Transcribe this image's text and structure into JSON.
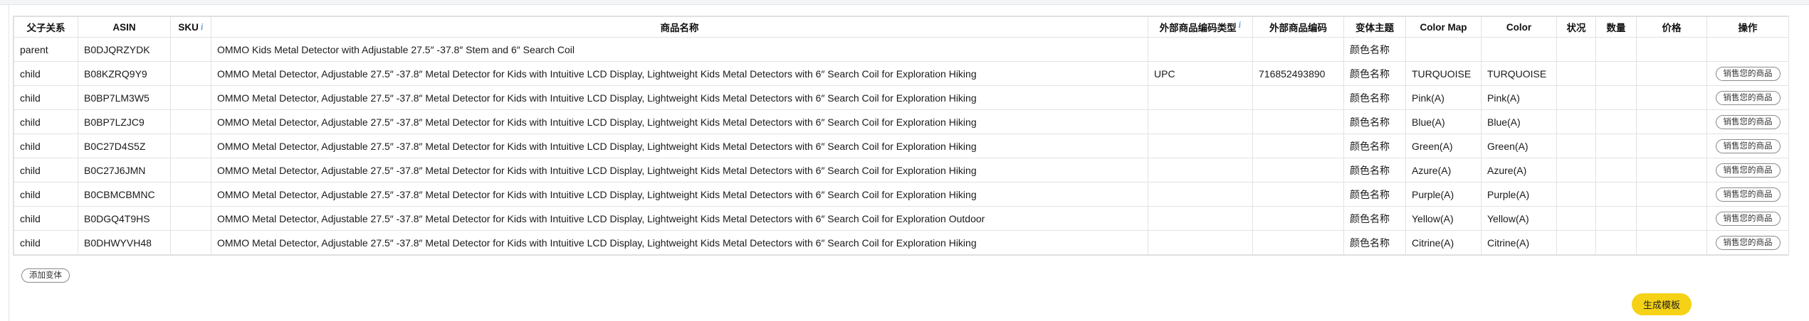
{
  "headers": {
    "relation": "父子关系",
    "asin": "ASIN",
    "sku": "SKU",
    "name": "商品名称",
    "ext_code_type": "外部商品编码类型",
    "ext_code": "外部商品编码",
    "theme": "变体主题",
    "color_map": "Color Map",
    "color": "Color",
    "status": "状况",
    "qty": "数量",
    "price": "价格",
    "action": "操作"
  },
  "info_glyph": "i",
  "rows": [
    {
      "relation": "parent",
      "asin": "B0DJQRZYDK",
      "sku": "",
      "name": "OMMO Kids Metal Detector with Adjustable 27.5″ -37.8″  Stem and 6″  Search Coil",
      "ext_code_type": "",
      "ext_code": "",
      "theme": "颜色名称",
      "color_map": "",
      "color": "",
      "status": "",
      "qty": "",
      "price": "",
      "action": ""
    },
    {
      "relation": "child",
      "asin": "B08KZRQ9Y9",
      "sku": "",
      "name": "OMMO Metal Detector, Adjustable 27.5″ -37.8″  Metal Detector for Kids with Intuitive LCD Display, Lightweight Kids Metal Detectors with 6″  Search Coil for Exploration Hiking",
      "ext_code_type": "UPC",
      "ext_code": "716852493890",
      "theme": "颜色名称",
      "color_map": "TURQUOISE",
      "color": "TURQUOISE",
      "status": "",
      "qty": "",
      "price": "",
      "action": "销售您的商品"
    },
    {
      "relation": "child",
      "asin": "B0BP7LM3W5",
      "sku": "",
      "name": "OMMO Metal Detector, Adjustable 27.5″ -37.8″  Metal Detector for Kids with Intuitive LCD Display, Lightweight Kids Metal Detectors with 6″  Search Coil for Exploration Hiking",
      "ext_code_type": "",
      "ext_code": "",
      "theme": "颜色名称",
      "color_map": "Pink(A)",
      "color": "Pink(A)",
      "status": "",
      "qty": "",
      "price": "",
      "action": "销售您的商品"
    },
    {
      "relation": "child",
      "asin": "B0BP7LZJC9",
      "sku": "",
      "name": "OMMO Metal Detector, Adjustable 27.5″ -37.8″  Metal Detector for Kids with Intuitive LCD Display, Lightweight Kids Metal Detectors with 6″  Search Coil for Exploration Hiking",
      "ext_code_type": "",
      "ext_code": "",
      "theme": "颜色名称",
      "color_map": "Blue(A)",
      "color": "Blue(A)",
      "status": "",
      "qty": "",
      "price": "",
      "action": "销售您的商品"
    },
    {
      "relation": "child",
      "asin": "B0C27D4S5Z",
      "sku": "",
      "name": "OMMO Metal Detector, Adjustable 27.5″ -37.8″  Metal Detector for Kids with Intuitive LCD Display, Lightweight Kids Metal Detectors with 6″  Search Coil for Exploration Hiking",
      "ext_code_type": "",
      "ext_code": "",
      "theme": "颜色名称",
      "color_map": "Green(A)",
      "color": "Green(A)",
      "status": "",
      "qty": "",
      "price": "",
      "action": "销售您的商品"
    },
    {
      "relation": "child",
      "asin": "B0C27J6JMN",
      "sku": "",
      "name": "OMMO Metal Detector, Adjustable 27.5″ -37.8″  Metal Detector for Kids with Intuitive LCD Display, Lightweight Kids Metal Detectors with 6″  Search Coil for Exploration Hiking",
      "ext_code_type": "",
      "ext_code": "",
      "theme": "颜色名称",
      "color_map": "Azure(A)",
      "color": "Azure(A)",
      "status": "",
      "qty": "",
      "price": "",
      "action": "销售您的商品"
    },
    {
      "relation": "child",
      "asin": "B0CBMCBMNC",
      "sku": "",
      "name": "OMMO Metal Detector, Adjustable 27.5″ -37.8″  Metal Detector for Kids with Intuitive LCD Display, Lightweight Kids Metal Detectors with 6″  Search Coil for Exploration Hiking",
      "ext_code_type": "",
      "ext_code": "",
      "theme": "颜色名称",
      "color_map": "Purple(A)",
      "color": "Purple(A)",
      "status": "",
      "qty": "",
      "price": "",
      "action": "销售您的商品"
    },
    {
      "relation": "child",
      "asin": "B0DGQ4T9HS",
      "sku": "",
      "name": "OMMO Metal Detector, Adjustable 27.5″ -37.8″  Metal Detector for Kids with Intuitive LCD Display, Lightweight Kids Metal Detectors with 6″  Search Coil for Exploration Outdoor",
      "ext_code_type": "",
      "ext_code": "",
      "theme": "颜色名称",
      "color_map": "Yellow(A)",
      "color": "Yellow(A)",
      "status": "",
      "qty": "",
      "price": "",
      "action": "销售您的商品"
    },
    {
      "relation": "child",
      "asin": "B0DHWYVH48",
      "sku": "",
      "name": "OMMO Metal Detector, Adjustable 27.5″ -37.8″  Metal Detector for Kids with Intuitive LCD Display, Lightweight Kids Metal Detectors with 6″  Search Coil for Exploration Hiking",
      "ext_code_type": "",
      "ext_code": "",
      "theme": "颜色名称",
      "color_map": "Citrine(A)",
      "color": "Citrine(A)",
      "status": "",
      "qty": "",
      "price": "",
      "action": "销售您的商品"
    }
  ],
  "buttons": {
    "add_variant": "添加变体",
    "generate_template": "生成模板"
  },
  "colors": {
    "accent_yellow": "#f5d216",
    "info_blue": "#3a7bd5",
    "border": "#e2e2e2"
  }
}
